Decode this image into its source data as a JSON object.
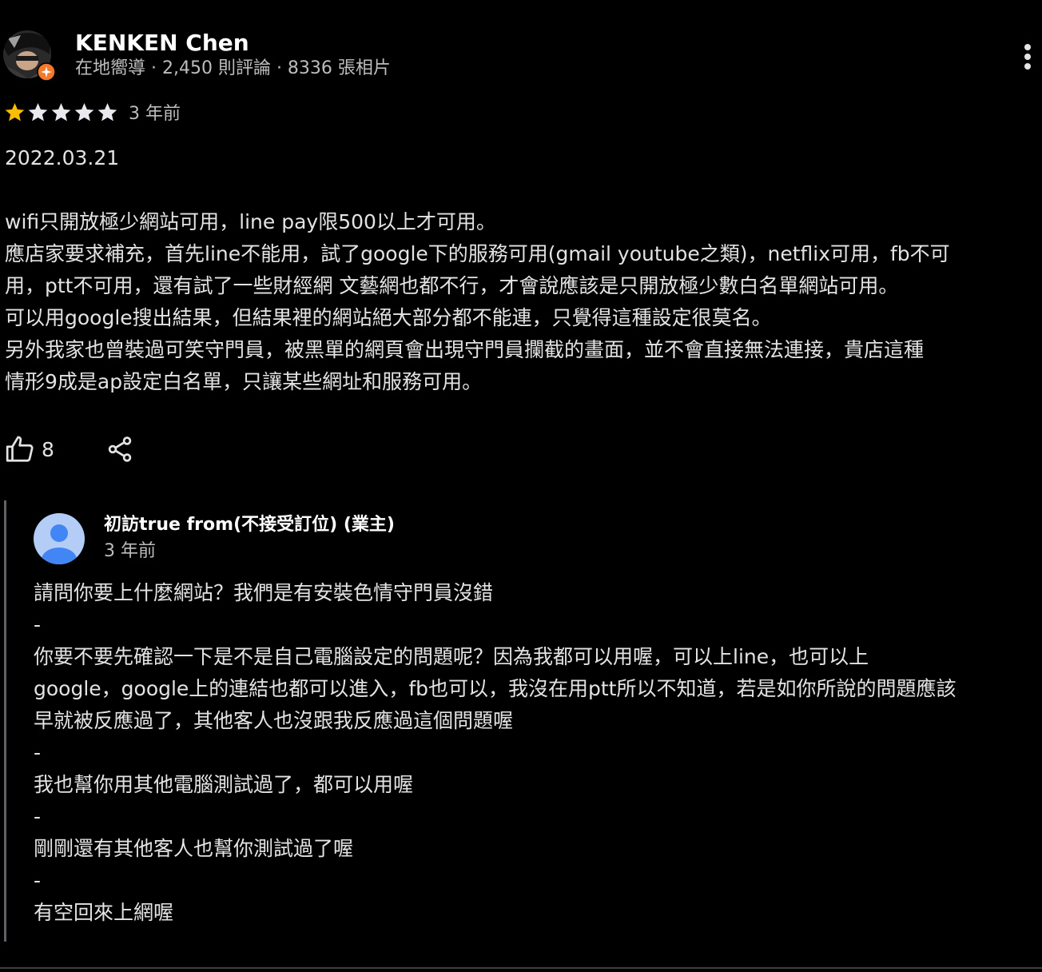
{
  "review": {
    "author_name": "KENKEN Chen",
    "author_meta": "在地嚮導 · 2,450 則評論 · 8336 張相片",
    "rating": 1,
    "rating_max": 5,
    "time": "3 年前",
    "body_lines": [
      "2022.03.21",
      "",
      "wifi只開放極少網站可用，line pay限500以上才可用。",
      "應店家要求補充，首先line不能用，試了google下的服務可用(gmail youtube之類)，netflix可用，fb不可",
      "用，ptt不可用，還有試了一些財經網 文藝網也都不行，才會說應該是只開放極少數白名單網站可用。",
      "可以用google搜出結果，但結果裡的網站絕大部分都不能連，只覺得這種設定很莫名。",
      "另外我家也曾裝過可笑守門員，被黑單的網頁會出現守門員攔截的畫面，並不會直接無法連接，貴店這種",
      "情形9成是ap設定白名單，只讓某些網址和服務可用。"
    ],
    "like_count": "8"
  },
  "owner_reply": {
    "owner_name": "初訪true from(不接受訂位) (業主)",
    "time": "3 年前",
    "body_lines": [
      "請問你要上什麼網站？我們是有安裝色情守門員沒錯",
      "-",
      "你要不要先確認一下是不是自己電腦設定的問題呢？因為我都可以用喔，可以上line，也可以上",
      "google，google上的連結也都可以進入，fb也可以，我沒在用ptt所以不知道，若是如你所說的問題應該",
      "早就被反應過了，其他客人也沒跟我反應過這個問題喔",
      "-",
      "我也幫你用其他電腦測試過了，都可以用喔",
      "-",
      "剛剛還有其他客人也幫你測試過了喔",
      "-",
      "有空回來上網喔"
    ]
  },
  "colors": {
    "background": "#000000",
    "text_primary": "#e3e3e3",
    "text_secondary": "#bdbdbd",
    "star_filled": "#fbbc04",
    "star_empty": "#e8eaed",
    "local_guide_badge": "#f4792b",
    "default_avatar": "#8ab4f8"
  },
  "icons": {
    "more": "more-vert-icon",
    "like": "thumb-up-icon",
    "share": "share-icon",
    "star": "star-icon",
    "badge": "local-guide-badge-icon"
  }
}
